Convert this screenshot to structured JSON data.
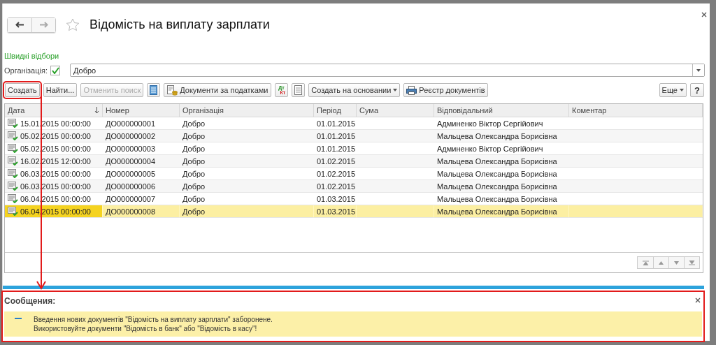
{
  "window": {
    "title": "Відомість на виплату зарплати",
    "favorite": false
  },
  "quick_filters": {
    "title": "Швидкі відбори",
    "organization": {
      "label": "Організація:",
      "checked": true,
      "value": "Добро"
    }
  },
  "toolbar": [
    {
      "kind": "text",
      "label": "Создать",
      "disabled": false,
      "highlighted": true
    },
    {
      "kind": "text",
      "label": "Найти...",
      "disabled": false,
      "highlighted": false
    },
    {
      "kind": "text",
      "label": "Отменить поиск",
      "disabled": true,
      "highlighted": false
    },
    {
      "kind": "list",
      "disabled": false,
      "highlighted": false
    },
    {
      "kind": "docs",
      "label": "Документи за податками",
      "disabled": false,
      "highlighted": false
    },
    {
      "kind": "dtkt",
      "top": "Дт",
      "bottom": "Кт",
      "disabled": false,
      "highlighted": false
    },
    {
      "kind": "sheet",
      "disabled": false,
      "highlighted": false
    },
    {
      "kind": "menu",
      "label": "Создать на основании",
      "disabled": false,
      "highlighted": false
    },
    {
      "kind": "print",
      "label": "Реєстр документів",
      "disabled": false,
      "highlighted": false
    }
  ],
  "toolbar_right": [
    {
      "kind": "menu",
      "label": "Еще"
    },
    {
      "kind": "text",
      "label": "?"
    }
  ],
  "table": {
    "columns": [
      {
        "label": "Дата",
        "sorted": true
      },
      {
        "label": "Номер",
        "sorted": false
      },
      {
        "label": "Організація",
        "sorted": false
      },
      {
        "label": "Період",
        "sorted": false
      },
      {
        "label": "Сума",
        "sorted": false
      },
      {
        "label": "Відповідальний",
        "sorted": false
      },
      {
        "label": "Коментар",
        "sorted": false
      }
    ],
    "rows": [
      {
        "cells": [
          "15.01.2015 00:00:00",
          "ДО000000001",
          "Добро",
          "01.01.2015",
          "",
          "Админенко Віктор Сергійович",
          ""
        ],
        "selected": false
      },
      {
        "cells": [
          "05.02.2015 00:00:00",
          "ДО000000002",
          "Добро",
          "01.01.2015",
          "",
          "Мальцева Олександра Борисівна",
          ""
        ],
        "selected": false
      },
      {
        "cells": [
          "05.02.2015 00:00:00",
          "ДО000000003",
          "Добро",
          "01.01.2015",
          "",
          "Админенко Віктор Сергійович",
          ""
        ],
        "selected": false
      },
      {
        "cells": [
          "16.02.2015 12:00:00",
          "ДО000000004",
          "Добро",
          "01.02.2015",
          "",
          "Мальцева Олександра Борисівна",
          ""
        ],
        "selected": false
      },
      {
        "cells": [
          "06.03.2015 00:00:00",
          "ДО000000005",
          "Добро",
          "01.02.2015",
          "",
          "Мальцева Олександра Борисівна",
          ""
        ],
        "selected": false
      },
      {
        "cells": [
          "06.03.2015 00:00:00",
          "ДО000000006",
          "Добро",
          "01.02.2015",
          "",
          "Мальцева Олександра Борисівна",
          ""
        ],
        "selected": false
      },
      {
        "cells": [
          "06.04.2015 00:00:00",
          "ДО000000007",
          "Добро",
          "01.03.2015",
          "",
          "Мальцева Олександра Борисівна",
          ""
        ],
        "selected": false
      },
      {
        "cells": [
          "06.04.2015 00:00:00",
          "ДО000000008",
          "Добро",
          "01.03.2015",
          "",
          "Мальцева Олександра Борисівна",
          ""
        ],
        "selected": true
      }
    ]
  },
  "messages": {
    "title": "Сообщения:",
    "highlighted": true,
    "items": [
      {
        "lines": [
          "Введення нових документів \"Відомість на виплату зарплати\" заборонене.",
          "Використовуйте документи \"Відомість в банк\" або \"Відомість в касу\"!"
        ]
      }
    ]
  }
}
